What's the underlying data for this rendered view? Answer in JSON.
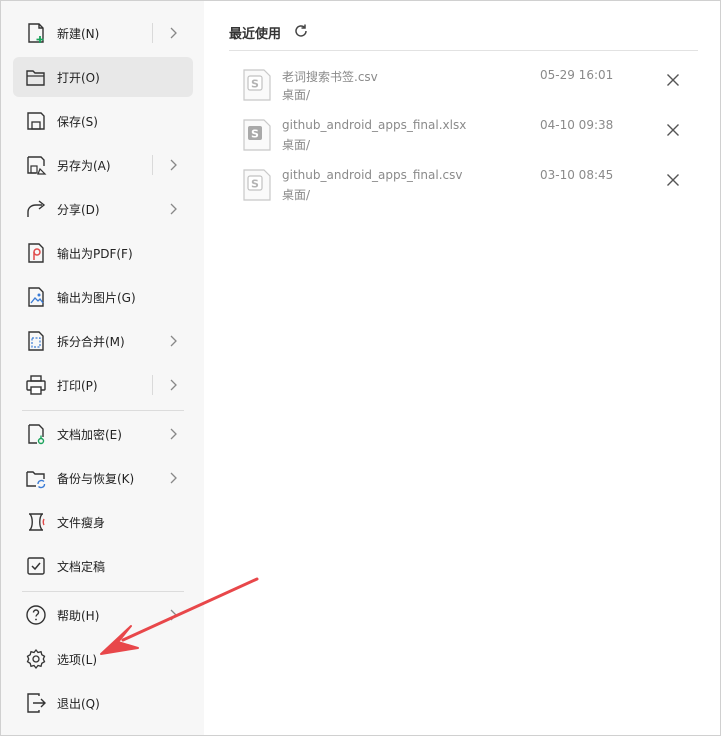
{
  "sidebar": {
    "items": [
      {
        "label": "新建(N)",
        "icon": "new-file-icon",
        "has_arrow": true,
        "split": true
      },
      {
        "label": "打开(O)",
        "icon": "open-folder-icon",
        "active": true
      },
      {
        "label": "保存(S)",
        "icon": "save-icon"
      },
      {
        "label": "另存为(A)",
        "icon": "save-as-icon",
        "has_arrow": true,
        "split": true
      },
      {
        "label": "分享(D)",
        "icon": "share-icon",
        "has_arrow": true
      },
      {
        "label": "输出为PDF(F)",
        "icon": "export-pdf-icon"
      },
      {
        "label": "输出为图片(G)",
        "icon": "export-image-icon"
      },
      {
        "label": "拆分合并(M)",
        "icon": "split-merge-icon",
        "has_arrow": true
      },
      {
        "label": "打印(P)",
        "icon": "print-icon",
        "has_arrow": true,
        "split": true
      },
      {
        "label": "文档加密(E)",
        "icon": "encrypt-icon",
        "has_arrow": true
      },
      {
        "label": "备份与恢复(K)",
        "icon": "backup-restore-icon",
        "has_arrow": true
      },
      {
        "label": "文件瘦身",
        "icon": "file-slim-icon"
      },
      {
        "label": "文档定稿",
        "icon": "finalize-icon"
      },
      {
        "label": "帮助(H)",
        "icon": "help-icon",
        "has_arrow": true
      },
      {
        "label": "选项(L)",
        "icon": "gear-icon"
      },
      {
        "label": "退出(Q)",
        "icon": "exit-icon"
      }
    ]
  },
  "recent": {
    "title": "最近使用",
    "files": [
      {
        "name": "老词搜索书签.csv",
        "path": "桌面/",
        "time": "05-29 16:01",
        "icon_style": "csv"
      },
      {
        "name": "github_android_apps_final.xlsx",
        "path": "桌面/",
        "time": "04-10 09:38",
        "icon_style": "xlsx"
      },
      {
        "name": "github_android_apps_final.csv",
        "path": "桌面/",
        "time": "03-10 08:45",
        "icon_style": "csv"
      }
    ]
  },
  "colors": {
    "sidebar_bg": "#f7f7f7",
    "active_bg": "#e8e8e8",
    "annotation_arrow": "#e8474a"
  }
}
